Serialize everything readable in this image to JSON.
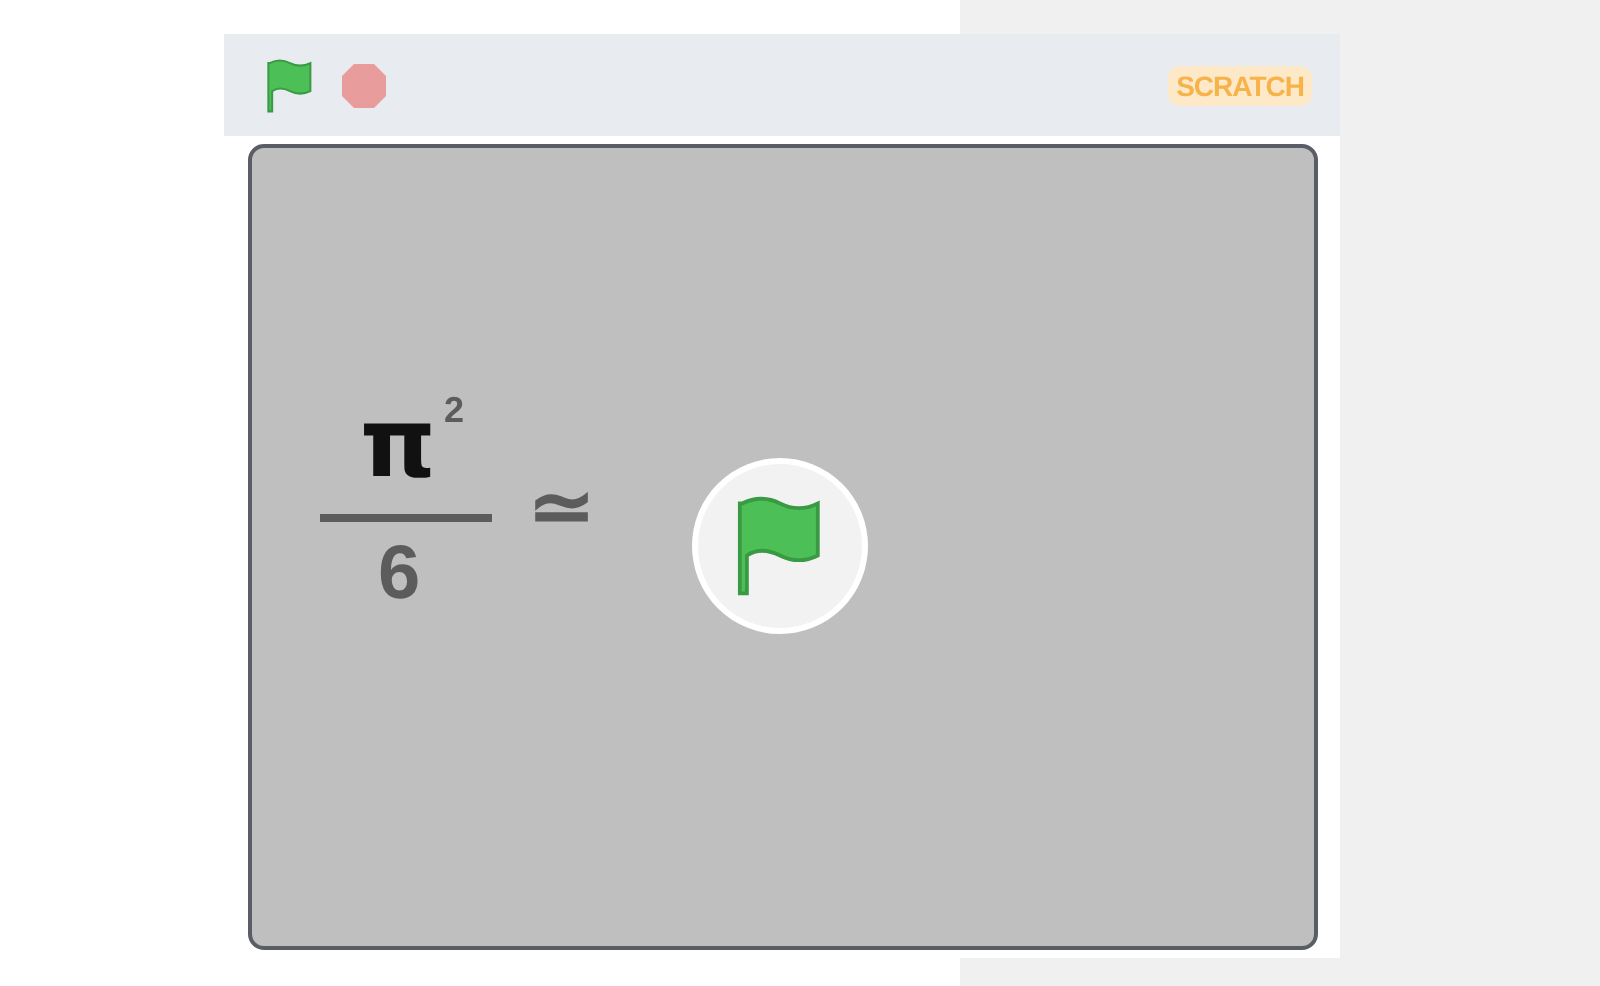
{
  "header": {
    "logo": "SCRATCH"
  },
  "stage": {
    "formula": {
      "numerator": "π",
      "exponent": "2",
      "denominator": "6",
      "relation": "≃"
    }
  }
}
